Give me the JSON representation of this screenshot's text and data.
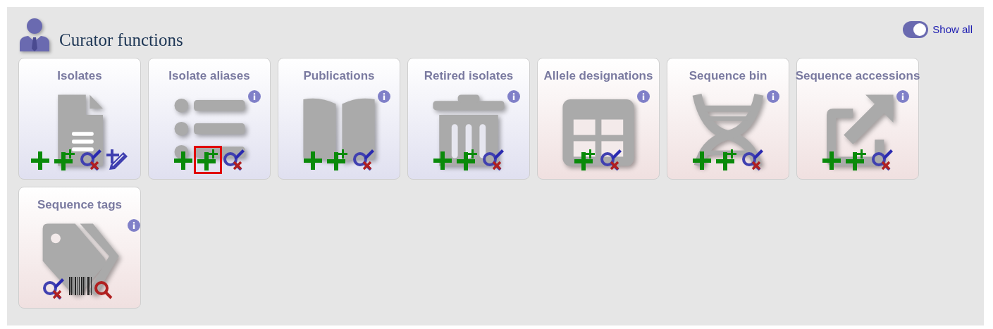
{
  "header": {
    "title": "Curator functions"
  },
  "show_all": {
    "label": "Show all",
    "on": true
  },
  "tiles": [
    {
      "title": "Isolates",
      "color": "#e0e0f0",
      "info": false,
      "kind": "document",
      "actions": [
        {
          "kind": "add",
          "highlighted": false
        },
        {
          "kind": "batch_add",
          "highlighted": false
        },
        {
          "kind": "query",
          "highlighted": false
        },
        {
          "kind": "batch_edit",
          "highlighted": false
        }
      ]
    },
    {
      "title": "Isolate aliases",
      "color": "#e0e0f0",
      "info": true,
      "kind": "list",
      "actions": [
        {
          "kind": "add",
          "highlighted": false
        },
        {
          "kind": "batch_add",
          "highlighted": true
        },
        {
          "kind": "query",
          "highlighted": false
        }
      ]
    },
    {
      "title": "Publications",
      "color": "#e0e0f0",
      "info": true,
      "kind": "book",
      "actions": [
        {
          "kind": "add",
          "highlighted": false
        },
        {
          "kind": "batch_add",
          "highlighted": false
        },
        {
          "kind": "query",
          "highlighted": false
        }
      ]
    },
    {
      "title": "Retired isolates",
      "color": "#e0e0f0",
      "info": true,
      "kind": "trash",
      "actions": [
        {
          "kind": "add",
          "highlighted": false
        },
        {
          "kind": "batch_add",
          "highlighted": false
        },
        {
          "kind": "query",
          "highlighted": false
        }
      ]
    },
    {
      "title": "Allele designations",
      "color": "#f0e0e0",
      "info": true,
      "kind": "table",
      "actions": [
        {
          "kind": "batch_add",
          "highlighted": false
        },
        {
          "kind": "query",
          "highlighted": false
        }
      ]
    },
    {
      "title": "Sequence bin",
      "color": "#f0e0e0",
      "info": true,
      "kind": "dna",
      "actions": [
        {
          "kind": "add",
          "highlighted": false
        },
        {
          "kind": "batch_add",
          "highlighted": false
        },
        {
          "kind": "query",
          "highlighted": false
        }
      ]
    },
    {
      "title": "Sequence accessions",
      "color": "#f0e0e0",
      "info": true,
      "kind": "external",
      "actions": [
        {
          "kind": "add",
          "highlighted": false
        },
        {
          "kind": "batch_add",
          "highlighted": false
        },
        {
          "kind": "query",
          "highlighted": false
        }
      ]
    },
    {
      "title": "Sequence tags",
      "color": "#f0e0e0",
      "info": true,
      "kind": "tags",
      "actions": [
        {
          "kind": "query",
          "highlighted": false
        },
        {
          "kind": "scan",
          "highlighted": false
        }
      ]
    }
  ]
}
